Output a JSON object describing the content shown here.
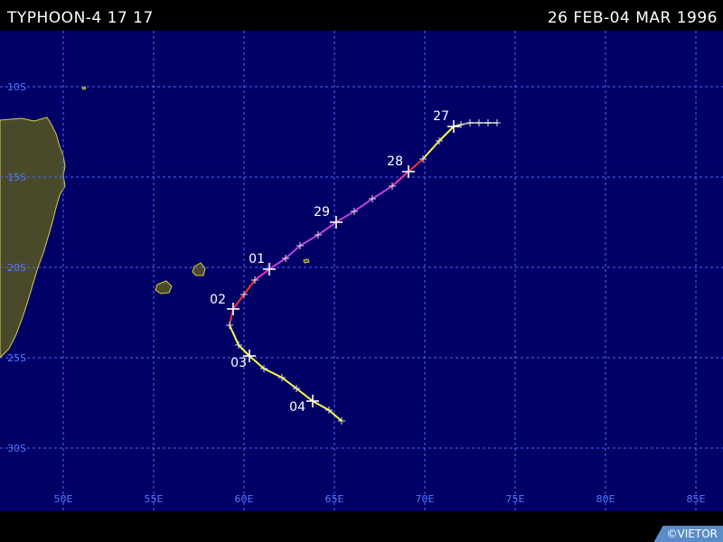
{
  "header": {
    "storm_name": "TYPHOON-4 17 17",
    "date_range": "26 FEB-04 MAR 1996"
  },
  "map": {
    "background_color": "#000066",
    "land_color": "#4a4a2a",
    "grid_color": "#4a6aff",
    "lat_labels": [
      "10S",
      "15S",
      "20S",
      "25S",
      "30S"
    ],
    "lon_labels": [
      "50E",
      "55E",
      "60E",
      "65E",
      "70E",
      "75E",
      "80E",
      "85E"
    ],
    "credit": "©VIETOR"
  },
  "track": {
    "day_labels": [
      "27",
      "28",
      "29",
      "01",
      "02",
      "03",
      "04"
    ],
    "points": [
      {
        "lon": 74.0,
        "lat": -12.0,
        "intensity": "depression"
      },
      {
        "lon": 73.5,
        "lat": -12.0,
        "intensity": "depression"
      },
      {
        "lon": 73.0,
        "lat": -12.0,
        "intensity": "depression"
      },
      {
        "lon": 72.5,
        "lat": -12.0,
        "intensity": "depression"
      },
      {
        "lon": 72.0,
        "lat": -12.1,
        "intensity": "depression"
      },
      {
        "lon": 71.6,
        "lat": -12.2,
        "intensity": "tropical-storm"
      },
      {
        "lon": 70.8,
        "lat": -13.0,
        "intensity": "tropical-storm"
      },
      {
        "lon": 69.9,
        "lat": -14.0,
        "intensity": "tropical-storm"
      },
      {
        "lon": 69.1,
        "lat": -14.7,
        "intensity": "category-1"
      },
      {
        "lon": 68.2,
        "lat": -15.5,
        "intensity": "category-2"
      },
      {
        "lon": 67.1,
        "lat": -16.2,
        "intensity": "category-3"
      },
      {
        "lon": 66.1,
        "lat": -16.9,
        "intensity": "category-3"
      },
      {
        "lon": 65.1,
        "lat": -17.5,
        "intensity": "category-3"
      },
      {
        "lon": 64.1,
        "lat": -18.2,
        "intensity": "category-3"
      },
      {
        "lon": 63.1,
        "lat": -18.8,
        "intensity": "category-3"
      },
      {
        "lon": 62.3,
        "lat": -19.5,
        "intensity": "category-3"
      },
      {
        "lon": 61.4,
        "lat": -20.1,
        "intensity": "category-3"
      },
      {
        "lon": 60.6,
        "lat": -20.7,
        "intensity": "category-2"
      },
      {
        "lon": 60.0,
        "lat": -21.5,
        "intensity": "category-1"
      },
      {
        "lon": 59.4,
        "lat": -22.3,
        "intensity": "category-1"
      },
      {
        "lon": 59.2,
        "lat": -23.2,
        "intensity": "category-1"
      },
      {
        "lon": 59.7,
        "lat": -24.3,
        "intensity": "tropical-storm"
      },
      {
        "lon": 60.3,
        "lat": -24.9,
        "intensity": "tropical-storm"
      },
      {
        "lon": 61.1,
        "lat": -25.6,
        "intensity": "tropical-storm"
      },
      {
        "lon": 62.1,
        "lat": -26.1,
        "intensity": "tropical-storm"
      },
      {
        "lon": 62.9,
        "lat": -26.7,
        "intensity": "tropical-storm"
      },
      {
        "lon": 63.8,
        "lat": -27.4,
        "intensity": "tropical-storm"
      },
      {
        "lon": 64.7,
        "lat": -27.9,
        "intensity": "tropical-storm"
      },
      {
        "lon": 65.4,
        "lat": -28.5,
        "intensity": "tropical-storm"
      }
    ],
    "day_markers": [
      {
        "label_index": 0,
        "point_index": 5
      },
      {
        "label_index": 1,
        "point_index": 8
      },
      {
        "label_index": 2,
        "point_index": 12
      },
      {
        "label_index": 3,
        "point_index": 16
      },
      {
        "label_index": 4,
        "point_index": 19
      },
      {
        "label_index": 5,
        "point_index": 22
      },
      {
        "label_index": 6,
        "point_index": 26
      }
    ],
    "intensity_colors": {
      "depression": "#9a9a9a",
      "tropical-storm": "#ffff44",
      "category-1": "#ff3030",
      "category-2": "#ff30c0",
      "category-3": "#c040e0"
    }
  }
}
